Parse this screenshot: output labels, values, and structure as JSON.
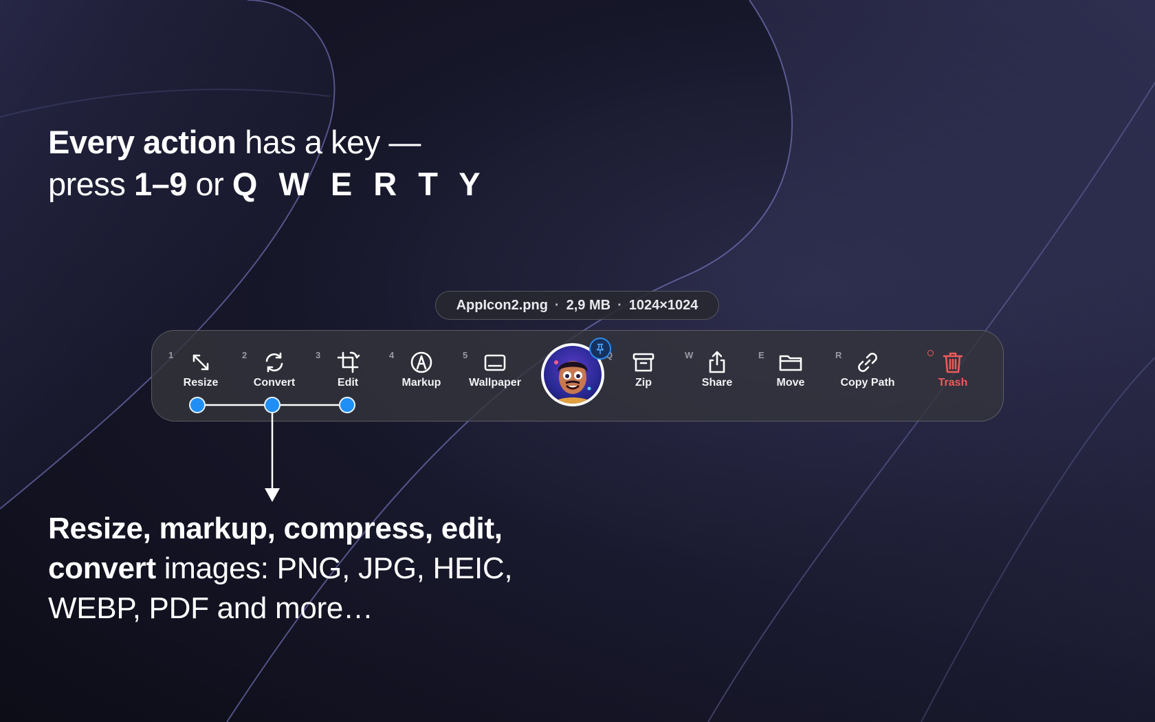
{
  "headline": {
    "line1_bold": "Every action",
    "line1_rest": " has a key —",
    "line2_a": "press ",
    "line2_keys_num": "1–9",
    "line2_b": " or ",
    "line2_keys_letters": "Q W E R T Y"
  },
  "file_info": {
    "filename": "AppIcon2.png",
    "size": "2,9 MB",
    "dimensions": "1024×1024",
    "separator": "·"
  },
  "toolbar": {
    "actions": [
      {
        "key": "1",
        "label": "Resize",
        "icon": "resize-icon"
      },
      {
        "key": "2",
        "label": "Convert",
        "icon": "convert-icon"
      },
      {
        "key": "3",
        "label": "Edit",
        "icon": "crop-icon"
      },
      {
        "key": "4",
        "label": "Markup",
        "icon": "markup-icon"
      },
      {
        "key": "5",
        "label": "Wallpaper",
        "icon": "wallpaper-icon"
      },
      {
        "key": "Q",
        "label": "Zip",
        "icon": "archive-icon"
      },
      {
        "key": "W",
        "label": "Share",
        "icon": "share-icon"
      },
      {
        "key": "E",
        "label": "Move",
        "icon": "folder-icon"
      },
      {
        "key": "R",
        "label": "Copy Path",
        "icon": "link-icon"
      },
      {
        "key": "",
        "label": "Trash",
        "icon": "trash-icon"
      }
    ],
    "thumbnail_icon": "app-icon-thumbnail",
    "pin_icon": "pin-icon"
  },
  "caption": {
    "bold_1": "Resize, markup, compress, edit,",
    "bold_2": "convert",
    "rest_2": " images: PNG, JPG, HEIC,",
    "line3": "WEBP, PDF and more…"
  },
  "colors": {
    "accent_blue": "#1f8ff5",
    "trash_red": "#ee5a5a"
  }
}
